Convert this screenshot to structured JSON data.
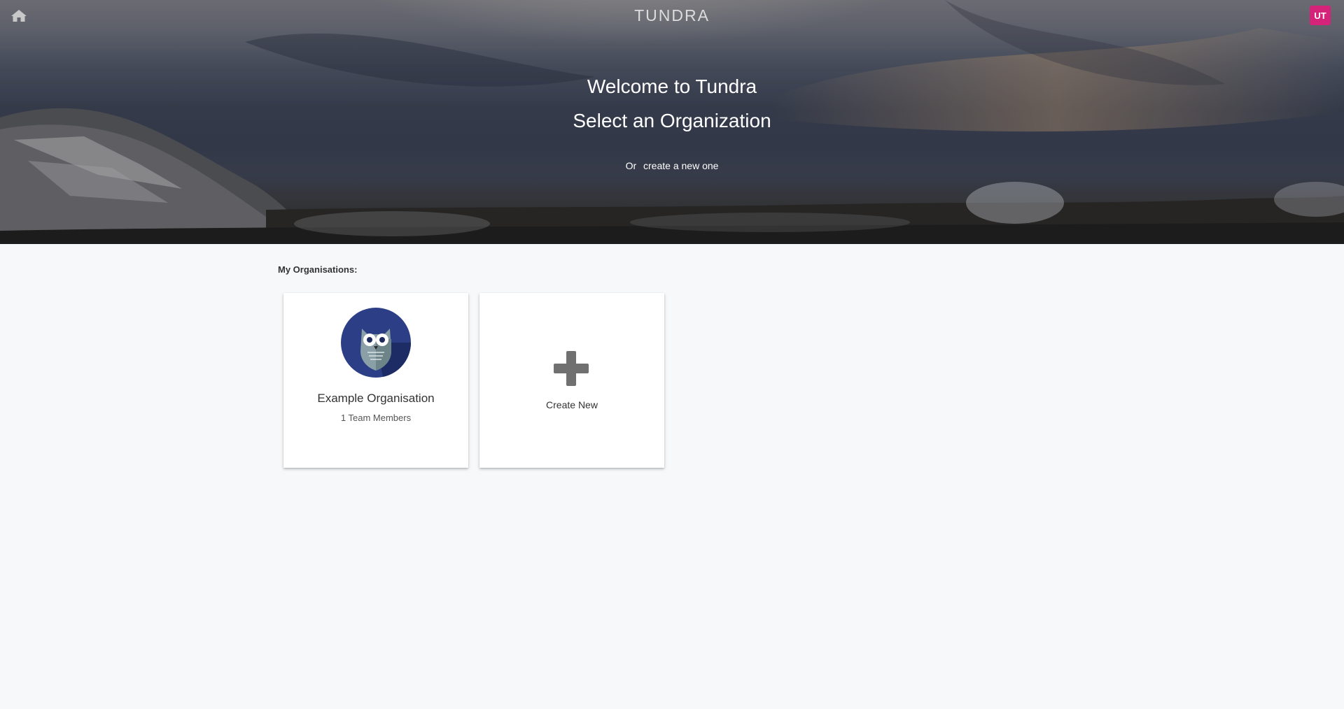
{
  "header": {
    "brand": "TUNDRA",
    "user_initials": "UT",
    "avatar_color": "#d6237a",
    "home_icon": "home-icon"
  },
  "hero": {
    "welcome": "Welcome to Tundra",
    "subtitle": "Select an Organization",
    "or_prefix": "Or",
    "create_link": "create a new one"
  },
  "main": {
    "section_label": "My Organisations:",
    "organisations": [
      {
        "name": "Example Organisation",
        "members": "1 Team Members",
        "logo_icon": "owl-logo-icon"
      }
    ],
    "create_card": {
      "label": "Create New",
      "icon": "plus-icon"
    }
  }
}
